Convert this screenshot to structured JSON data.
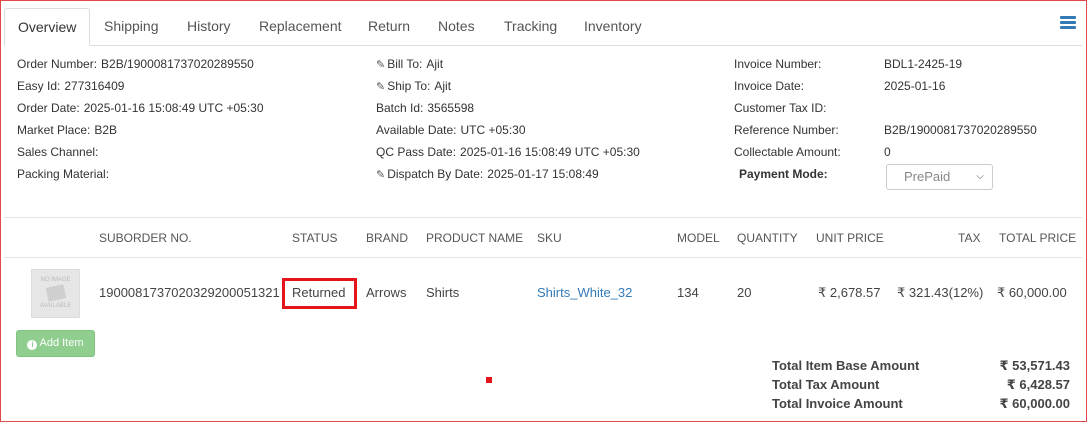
{
  "tabs": [
    {
      "label": "Overview",
      "active": true
    },
    {
      "label": "Shipping"
    },
    {
      "label": "History"
    },
    {
      "label": "Replacement"
    },
    {
      "label": "Return"
    },
    {
      "label": "Notes"
    },
    {
      "label": "Tracking"
    },
    {
      "label": "Inventory"
    }
  ],
  "order": {
    "order_number_label": "Order Number:",
    "order_number": "B2B/1900081737020289550",
    "easy_id_label": "Easy Id:",
    "easy_id": "277316409",
    "order_date_label": "Order Date:",
    "order_date": "2025-01-16 15:08:49 UTC +05:30",
    "market_place_label": "Market Place:",
    "market_place": "B2B",
    "sales_channel_label": "Sales Channel:",
    "packing_material_label": "Packing Material:"
  },
  "billing": {
    "bill_to_label": "Bill To:",
    "bill_to": "Ajit",
    "ship_to_label": "Ship To:",
    "ship_to": "Ajit",
    "batch_id_label": "Batch Id:",
    "batch_id": "3565598",
    "available_date_label": "Available Date:",
    "available_date": "UTC +05:30",
    "qc_pass_date_label": "QC Pass Date:",
    "qc_pass_date": "2025-01-16 15:08:49 UTC +05:30",
    "dispatch_by_label": "Dispatch By Date:",
    "dispatch_by": "2025-01-17 15:08:49"
  },
  "invoice": {
    "invoice_number_label": "Invoice Number:",
    "invoice_number": "BDL1-2425-19",
    "invoice_date_label": "Invoice Date:",
    "invoice_date": "2025-01-16",
    "customer_tax_id_label": "Customer Tax ID:",
    "reference_number_label": "Reference Number:",
    "reference_number": "B2B/1900081737020289550",
    "collectable_amount_label": "Collectable Amount:",
    "collectable_amount": "0",
    "payment_mode_label": "Payment Mode:",
    "payment_mode": "PrePaid"
  },
  "table": {
    "headers": {
      "suborder": "SUBORDER NO.",
      "status": "STATUS",
      "brand": "BRAND",
      "product_name": "PRODUCT NAME",
      "sku": "SKU",
      "model": "MODEL",
      "quantity": "QUANTITY",
      "unit_price": "UNIT PRICE",
      "tax": "TAX",
      "total_price": "TOTAL PRICE"
    },
    "rows": [
      {
        "image_text_1": "NO IMAGE",
        "image_text_2": "AVAILABLE",
        "suborder": "1900081737020329200051321",
        "status": "Returned",
        "brand": "Arrows",
        "product_name": "Shirts",
        "sku": "Shirts_White_32",
        "model": "134",
        "quantity": "20",
        "unit_price": "₹ 2,678.57",
        "tax": "₹ 321.43(12%)",
        "total_price": "₹ 60,000.00"
      }
    ]
  },
  "add_item_label": "Add Item",
  "totals": {
    "base_label": "Total Item Base Amount",
    "base_value": "₹ 53,571.43",
    "tax_label": "Total Tax Amount",
    "tax_value": "₹ 6,428.57",
    "invoice_label": "Total Invoice Amount",
    "invoice_value": "₹ 60,000.00"
  },
  "colors": {
    "accent": "#337ab7",
    "highlight": "#e4141b",
    "button": "#8fce8f"
  }
}
